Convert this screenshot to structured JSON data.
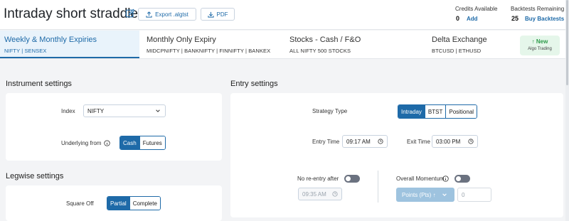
{
  "header": {
    "title": "Intraday short straddle",
    "export_label": "Export .algtst",
    "pdf_label": "PDF",
    "credits_label": "Credits Available",
    "credits_value": "0",
    "credits_add": "Add",
    "backtests_label": "Backtests Remaining",
    "backtests_value": "25",
    "buy_label": "Buy Backtests"
  },
  "tabs": [
    {
      "title": "Weekly & Monthly Expiries",
      "sub": "NIFTY | SENSEX",
      "active": true
    },
    {
      "title": "Monthly Only Expiry",
      "sub": "MIDCPNIFTY | BANKNIFTY | FINNIFTY | BANKEX",
      "active": false
    },
    {
      "title": "Stocks - Cash / F&O",
      "sub": "ALL NIFTY 500 STOCKS",
      "active": false
    },
    {
      "title": "Delta Exchange",
      "sub": "BTCUSD | ETHUSD",
      "active": false
    }
  ],
  "new_badge": {
    "label": "New",
    "sub": "Algo Trading"
  },
  "instrument": {
    "heading": "Instrument settings",
    "index_label": "Index",
    "index_value": "NIFTY",
    "underlying_label": "Underlying from",
    "underlying_options": [
      "Cash",
      "Futures"
    ],
    "underlying_selected": "Cash"
  },
  "legwise": {
    "heading": "Legwise settings",
    "square_off_label": "Square Off",
    "square_off_options": [
      "Partial",
      "Complete"
    ],
    "square_off_selected": "Partial"
  },
  "entry": {
    "heading": "Entry settings",
    "strategy_label": "Strategy Type",
    "strategy_options": [
      "Intraday",
      "BTST",
      "Positional"
    ],
    "strategy_selected": "Intraday",
    "entry_time_label": "Entry Time",
    "entry_time_value": "09:17 AM",
    "exit_time_label": "Exit Time",
    "exit_time_value": "03:00 PM",
    "reentry_label": "No re-entry after",
    "reentry_time": "09:35 AM",
    "momentum_label": "Overall Momentum",
    "points_label": "Points (Pts) ↑",
    "points_value": "0"
  },
  "colors": {
    "accent": "#1e6aa8",
    "active_tab_bg": "#e9f3fb",
    "new_green": "#2e9b4a"
  }
}
